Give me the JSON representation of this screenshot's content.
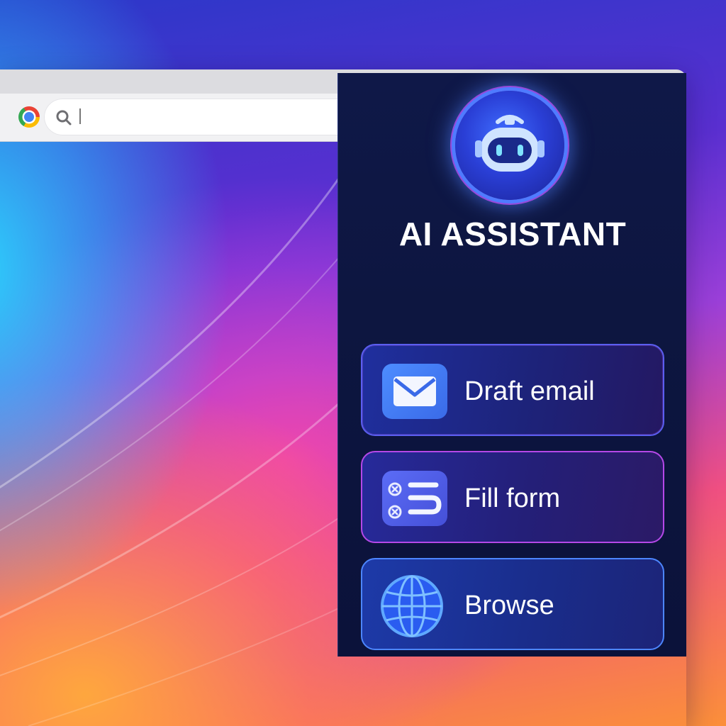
{
  "browser": {
    "omnibox": {
      "value": "",
      "placeholder": ""
    }
  },
  "assistant": {
    "title": "AI ASSISTANT",
    "actions": [
      {
        "id": "draft-email",
        "label": "Draft email",
        "icon": "mail-icon"
      },
      {
        "id": "fill-form",
        "label": "Fill form",
        "icon": "form-icon"
      },
      {
        "id": "browse",
        "label": "Browse",
        "icon": "globe-icon"
      }
    ]
  },
  "colors": {
    "panel_bg": "#0d1640",
    "accent_blue": "#4f7bff",
    "accent_purple": "#b548e8"
  }
}
